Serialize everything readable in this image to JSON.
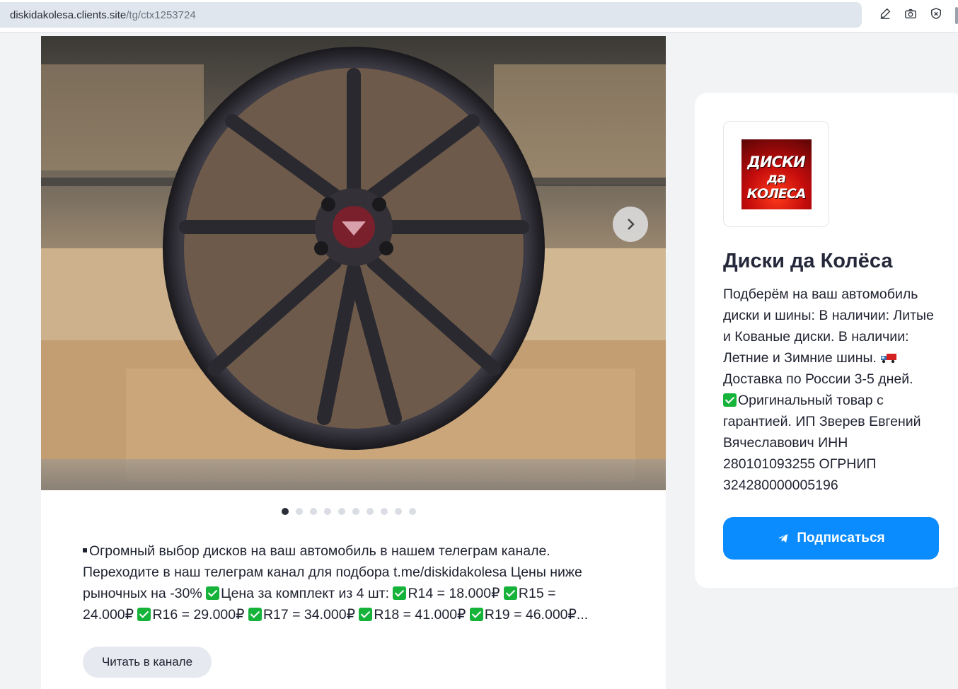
{
  "browser": {
    "url_host": "diskidakolesa.clients.site",
    "url_path": "/tg/ctx1253724",
    "icons": [
      "edit-icon",
      "camera-icon",
      "shield-icon"
    ]
  },
  "post": {
    "image_description_icon": "wheel-photo",
    "carousel": {
      "total": 10,
      "active_index": 0
    },
    "text_lines": [
      {
        "parts": [
          {
            "t": "sq"
          },
          {
            "t": "text",
            "v": "Огромный выбор дисков на ваш автомобиль в нашем телеграм канале."
          }
        ]
      },
      {
        "parts": [
          {
            "t": "text",
            "v": "Переходите в наш телеграм канал для подбора t.me/diskidakolesa Цены ниже"
          }
        ]
      },
      {
        "parts": [
          {
            "t": "text",
            "v": "рыночных на -30% "
          },
          {
            "t": "chk"
          },
          {
            "t": "text",
            "v": "Цена за комплект из 4 шт: "
          },
          {
            "t": "chk"
          },
          {
            "t": "text",
            "v": "R14 = 18.000₽ "
          },
          {
            "t": "chk"
          },
          {
            "t": "text",
            "v": "R15 ="
          }
        ]
      },
      {
        "parts": [
          {
            "t": "text",
            "v": "24.000₽ "
          },
          {
            "t": "chk"
          },
          {
            "t": "text",
            "v": "R16 = 29.000₽ "
          },
          {
            "t": "chk"
          },
          {
            "t": "text",
            "v": "R17 = 34.000₽ "
          },
          {
            "t": "chk"
          },
          {
            "t": "text",
            "v": "R18 = 41.000₽ "
          },
          {
            "t": "chk"
          },
          {
            "t": "text",
            "v": "R19 = 46.000₽..."
          }
        ]
      }
    ],
    "read_button_label": "Читать в канале"
  },
  "channel": {
    "avatar_line1": "ДИСКИ",
    "avatar_line2": "да КОЛЕСА",
    "name": "Диски да Колёса",
    "description_lines": [
      {
        "parts": [
          {
            "t": "text",
            "v": "Подберём на ваш автомобиль"
          }
        ]
      },
      {
        "parts": [
          {
            "t": "text",
            "v": "диски и шины: В наличии: Литые"
          }
        ]
      },
      {
        "parts": [
          {
            "t": "text",
            "v": "и Кованые диски. В наличии:"
          }
        ]
      },
      {
        "parts": [
          {
            "t": "text",
            "v": "Летние и Зимние шины. "
          },
          {
            "t": "truck"
          }
        ]
      },
      {
        "parts": [
          {
            "t": "text",
            "v": "Доставка по России 3-5 дней."
          }
        ]
      },
      {
        "parts": [
          {
            "t": "chk"
          },
          {
            "t": "text",
            "v": "Оригинальный товар с"
          }
        ]
      },
      {
        "parts": [
          {
            "t": "text",
            "v": "гарантией. ИП Зверев Евгений"
          }
        ]
      },
      {
        "parts": [
          {
            "t": "text",
            "v": "Вячеславович ИНН"
          }
        ]
      },
      {
        "parts": [
          {
            "t": "text",
            "v": "280101093255 ОГРНИП"
          }
        ]
      },
      {
        "parts": [
          {
            "t": "text",
            "v": "324280000005196"
          }
        ]
      }
    ],
    "subscribe_label": "Подписаться",
    "accent_color": "#0a8cff"
  }
}
